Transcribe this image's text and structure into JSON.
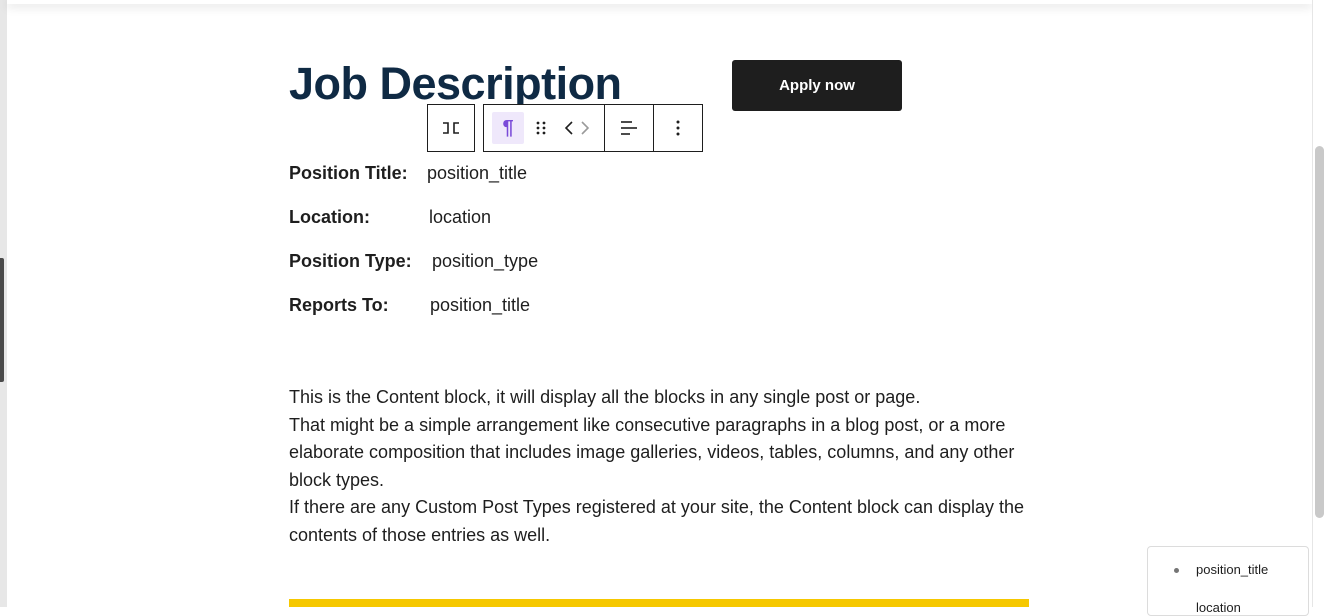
{
  "page": {
    "title": "Job Description",
    "apply_button": "Apply now"
  },
  "toolbar": {
    "groups": [
      {
        "name": "transform",
        "icon": "transform-icon"
      },
      {
        "name": "block",
        "items": [
          "paragraph-icon",
          "drag-handle-icon",
          "move-arrows-icon"
        ]
      },
      {
        "name": "align",
        "icon": "align-left-icon"
      },
      {
        "name": "options",
        "icon": "more-vertical-icon"
      }
    ],
    "paragraph_glyph": "¶",
    "accent_color": "#7a4ad8"
  },
  "fields": [
    {
      "label": "Position Title:",
      "value": "position_title"
    },
    {
      "label": "Location:",
      "value": "location"
    },
    {
      "label": "Position Type:",
      "value": "position_type"
    },
    {
      "label": "Reports To:",
      "value": "position_title"
    }
  ],
  "content": {
    "lines": [
      "This is the Content block, it will display all the blocks in any single post or page.",
      "That might be a simple arrangement like consecutive paragraphs in a blog post, or a more elaborate composition that includes image galleries, videos, tables, columns, and any other block types.",
      "If there are any Custom Post Types registered at your site, the Content block can display the contents of those entries as well."
    ]
  },
  "side_panel": {
    "items": [
      "position_title",
      "location"
    ]
  },
  "colors": {
    "title": "#0f2a44",
    "button_bg": "#1e1e1e",
    "highlight_bar": "#f6c800"
  }
}
